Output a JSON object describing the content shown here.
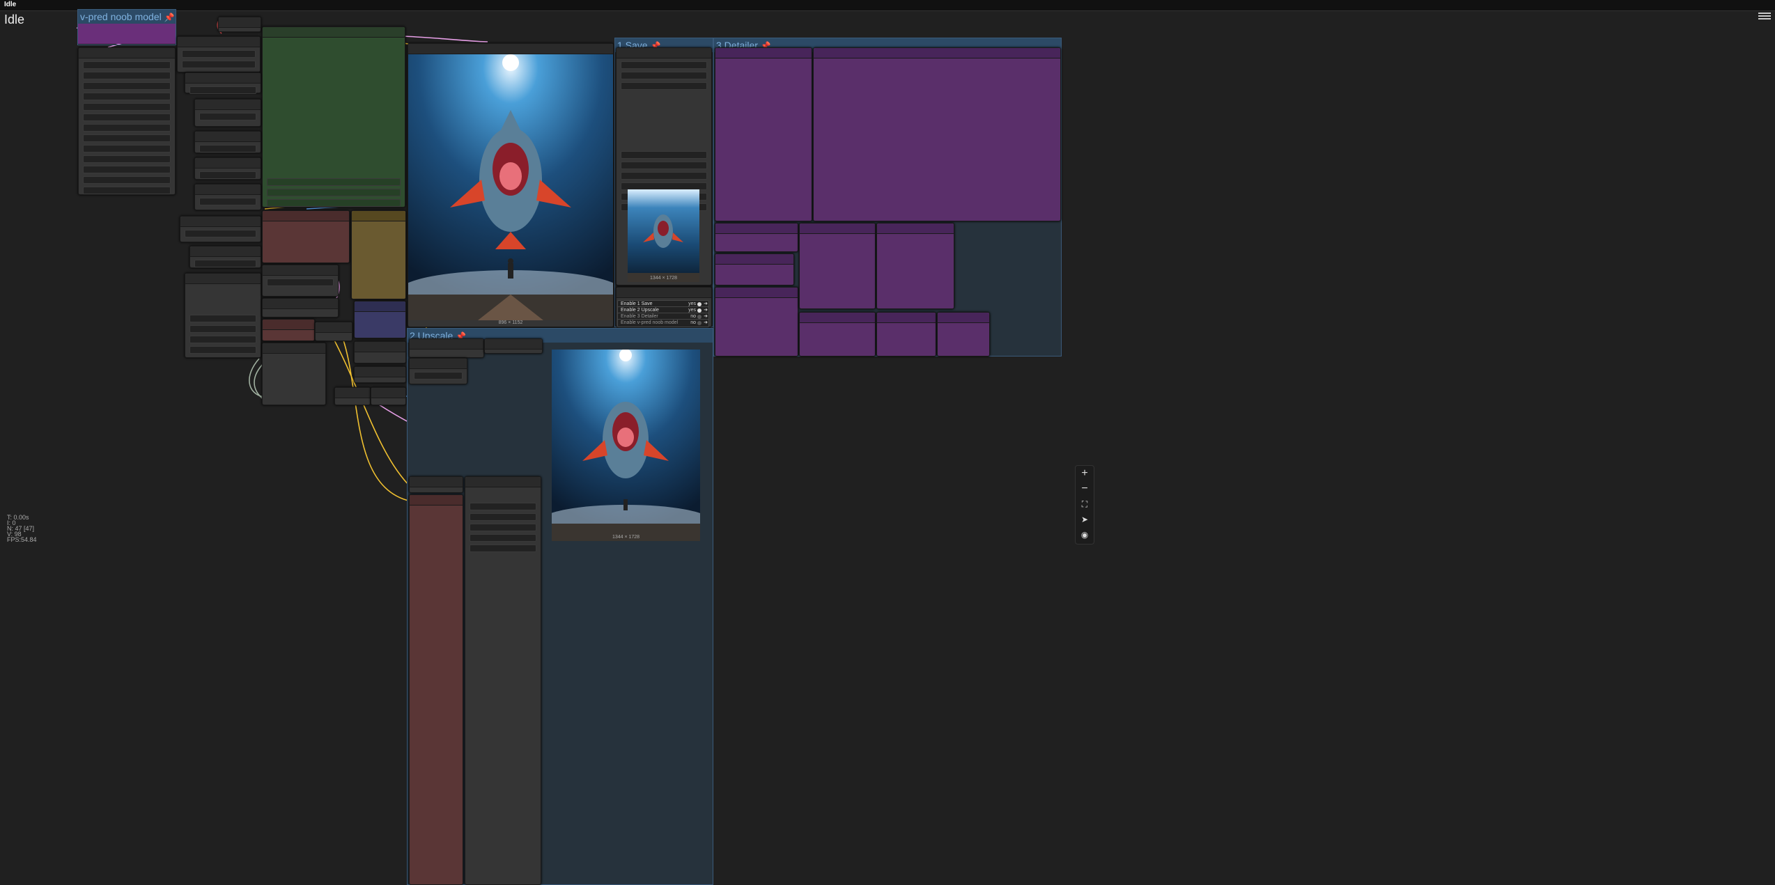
{
  "window": {
    "title": "Idle"
  },
  "status": {
    "title": "Idle",
    "sub": ""
  },
  "groups": {
    "model": {
      "title": "v-pred noob model"
    },
    "save": {
      "title": "1 Save"
    },
    "detailer": {
      "title": "3 Detailer"
    },
    "upscale": {
      "title": "2 Upscale"
    }
  },
  "main_image": {
    "caption": "896 × 1152"
  },
  "save_thumb": {
    "caption": "1344 × 1728"
  },
  "upscale_image": {
    "caption": "1344 × 1728"
  },
  "switches": [
    {
      "label": "Enable 1 Save",
      "value": "yes"
    },
    {
      "label": "Enable 2 Upscale",
      "value": "yes"
    },
    {
      "label": "Enable 3 Detailer",
      "value": "no"
    },
    {
      "label": "Enable v-pred noob model",
      "value": "no"
    }
  ],
  "stats": {
    "t": "T: 0.00s",
    "i": "I: 0",
    "n": "N: 47 [47]",
    "v": "V: 98",
    "fps": "FPS:54.84"
  },
  "colors": {
    "bg": "#202020",
    "group_header": "#2c4a66",
    "link_yellow": "#f0c030",
    "link_blue": "#64b0ff",
    "link_pink": "#e8a0e8"
  },
  "icons": [
    "hamburger-menu-icon",
    "zoom-in-icon",
    "zoom-out-icon",
    "fit-view-icon",
    "arrow-icon",
    "eye-icon",
    "pin-icon"
  ]
}
